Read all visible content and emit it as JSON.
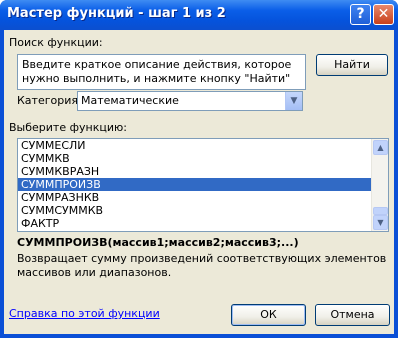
{
  "window": {
    "title": "Мастер функций - шаг 1 из 2",
    "help_glyph": "?",
    "close_glyph": "✕"
  },
  "search": {
    "label": "Поиск функции:",
    "text": "Введите краткое описание действия, которое нужно выполнить, и нажмите кнопку \"Найти\"",
    "find_button": "Найти"
  },
  "category": {
    "label": "Категория:",
    "selected": "Математические"
  },
  "function_list": {
    "label": "Выберите функцию:",
    "items": [
      "СУММЕСЛИ",
      "СУММКВ",
      "СУММКВРАЗН",
      "СУММПРОИЗВ",
      "СУММРАЗНКВ",
      "СУММСУММКВ",
      "ФАКТР"
    ],
    "selected_index": 3
  },
  "selected_function": {
    "signature": "СУММПРОИЗВ(массив1;массив2;массив3;...)",
    "description": "Возвращает сумму произведений соответствующих элементов массивов или диапазонов."
  },
  "footer": {
    "help_link": "Справка по этой функции",
    "ok_button": "ОК",
    "cancel_button": "Отмена"
  }
}
